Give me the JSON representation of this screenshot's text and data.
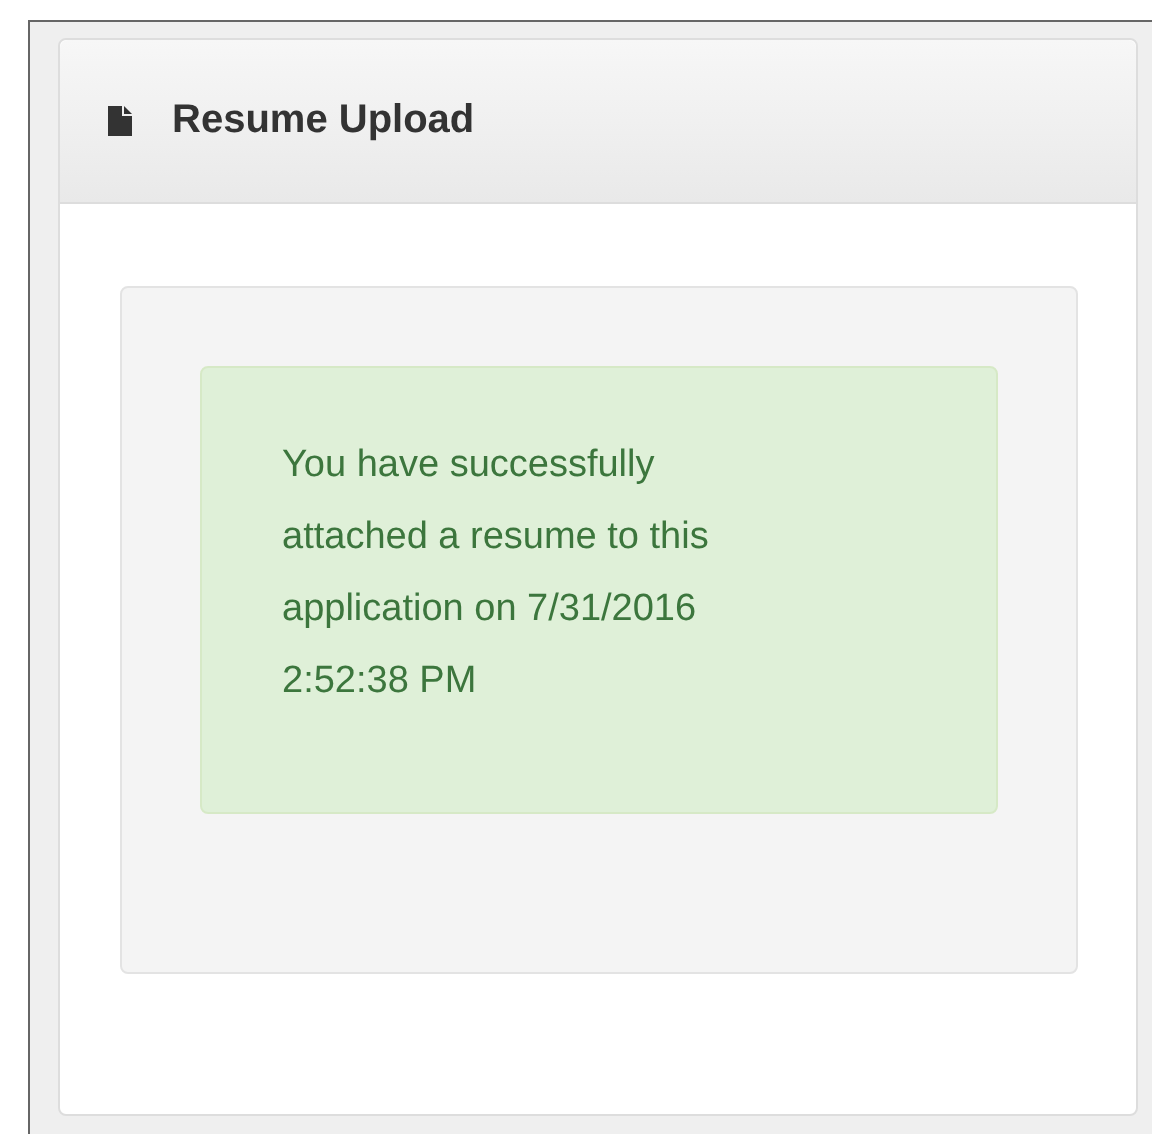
{
  "panel": {
    "title": "Resume Upload"
  },
  "alert": {
    "kind": "success",
    "message": "You have successfully attached a resume to this application on 7/31/2016 2:52:38 PM"
  }
}
